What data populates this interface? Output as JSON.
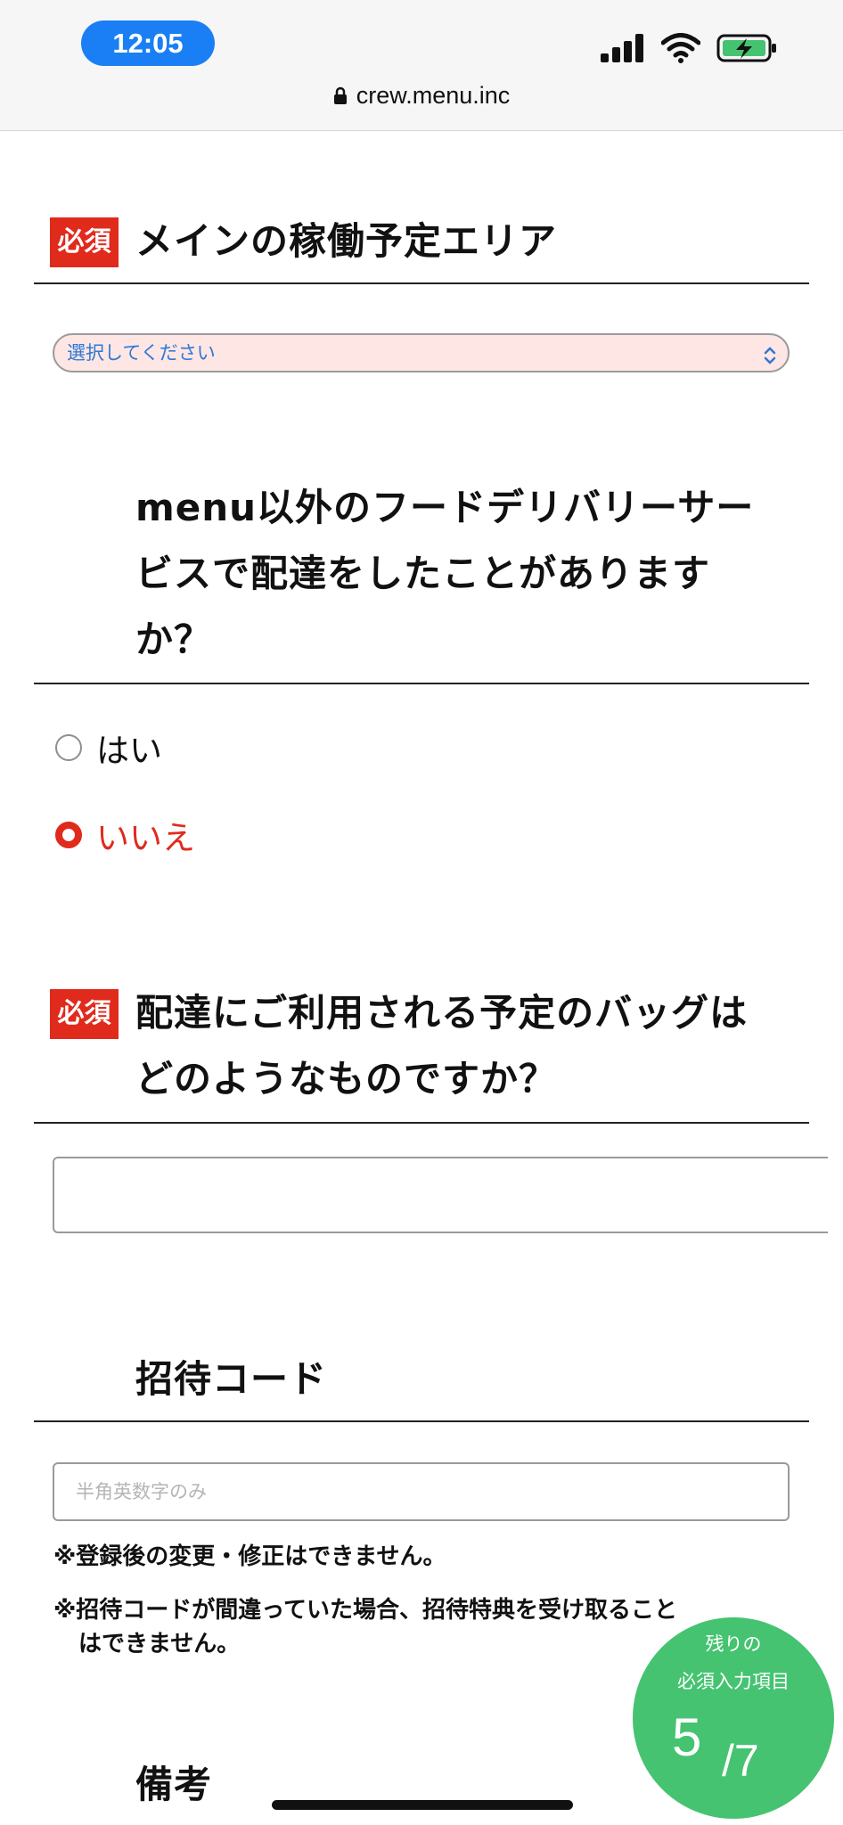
{
  "status_bar": {
    "time": "12:05",
    "url": "crew.menu.inc",
    "icons": [
      "cellular-signal-icon",
      "wifi-icon",
      "battery-charging-icon"
    ]
  },
  "colors": {
    "required_badge": "#e02a1c",
    "select_bg": "#fde6e4",
    "select_text": "#2e78d6",
    "counter_bg": "#45c371"
  },
  "area_section": {
    "badge": "必須",
    "title": "メインの稼働予定エリア",
    "select_placeholder": "選択してください"
  },
  "delivery_experience_section": {
    "title_lines": [
      "menu以外のフードデリバリーサー",
      "ビスで配達をしたことがあります",
      "か？"
    ],
    "options": [
      {
        "label": "はい",
        "selected": false
      },
      {
        "label": "いいえ",
        "selected": true
      }
    ]
  },
  "bag_section": {
    "badge": "必須",
    "title_lines": [
      "配達にご利用される予定のバッグは",
      "どのようなものですか？"
    ],
    "value": ""
  },
  "invite_section": {
    "title": "招待コード",
    "placeholder": "半角英数字のみ",
    "notes": [
      "※登録後の変更・修正はできません。",
      "※招待コードが間違っていた場合、招待特典を受け取ること",
      "はできません。"
    ]
  },
  "remarks_section": {
    "title": "備考"
  },
  "remaining_counter": {
    "line1": "残りの",
    "line2": "必須入力項目",
    "remaining": "5",
    "total": "/7"
  }
}
